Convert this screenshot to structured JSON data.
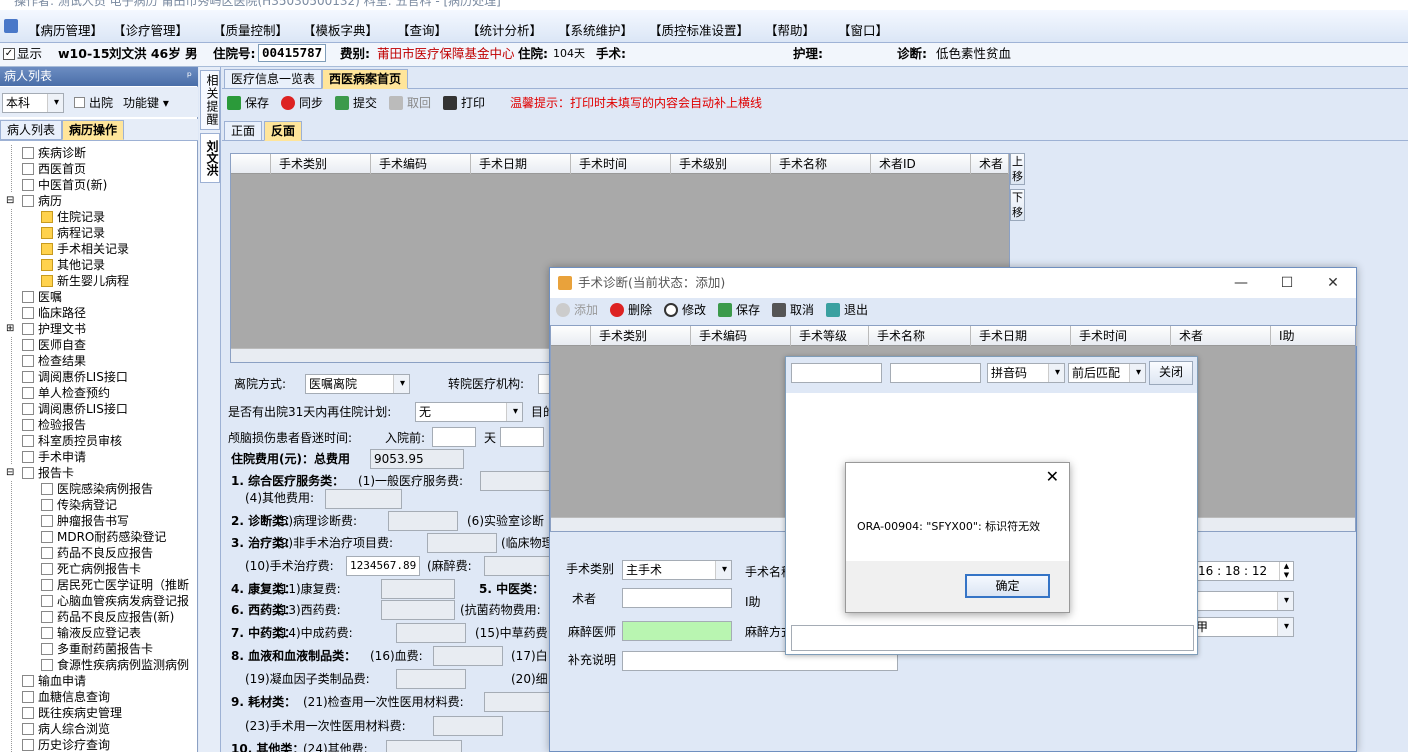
{
  "app": {
    "title_line": "操作者: 测试人员 电子病历 莆田市秀屿区医院(H35030500132) 科室: 五官科 - [病历处理]"
  },
  "menu": [
    "【病历管理】",
    "【诊疗管理】",
    "【质量控制】",
    "【模板字典】",
    "【查询】",
    "【统计分析】",
    "【系统维护】",
    "【质控标准设置】",
    "【帮助】",
    "【窗口】"
  ],
  "info": {
    "show_label": "显示",
    "bed": "w10-15",
    "patient": "刘文洪 46岁 男",
    "adm_no_label": "住院号:",
    "adm_no": "00415787",
    "insurance_label": "费别:",
    "insurance": "莆田市医疗保障基金中心",
    "stay_label": "住院:",
    "stay": "104天",
    "surgery_label": "手术:",
    "surgery": "",
    "nurse_label": "护理:",
    "nurse": "",
    "diag_label": "诊断:",
    "diag": "低色素性贫血"
  },
  "left": {
    "panel_title": "病人列表",
    "pin": "ᵖ",
    "dept": "本科",
    "discharge": "出院",
    "func_key": "功能键",
    "tab_list": "病人列表",
    "tab_ops": "病历操作",
    "tree": [
      "疾病诊断",
      "西医首页",
      "中医首页(新)",
      "病历",
      "住院记录",
      "病程记录",
      "手术相关记录",
      "其他记录",
      "新生婴儿病程",
      "医嘱",
      "临床路径",
      "护理文书",
      "医师自查",
      "检查结果",
      "调阅惠侨LIS接口",
      "单人检查预约",
      "调阅惠侨LIS接口",
      "检验报告",
      "科室质控员审核",
      "手术申请",
      "报告卡",
      "医院感染病例报告",
      "传染病登记",
      "肿瘤报告书写",
      "MDRO耐药感染登记",
      "药品不良反应报告",
      "死亡病例报告卡",
      "居民死亡医学证明（推断",
      "心脑血管疾病发病登记报",
      "药品不良反应报告(新)",
      "输液反应登记表",
      "多重耐药菌报告卡",
      "食源性疾病病例监测病例",
      "输血申请",
      "血糖信息查询",
      "既往疾病史管理",
      "病人综合浏览",
      "历史诊疗查询"
    ]
  },
  "side": {
    "tab_remind": "相关提醒",
    "tab_patient": "刘文洪"
  },
  "main": {
    "tab_overview": "医疗信息一览表",
    "tab_front": "西医病案首页",
    "toolbar": {
      "save": "保存",
      "sync": "同步",
      "submit": "提交",
      "cancel": "取回",
      "print": "打印",
      "tip": "温馨提示：打印时未填写的内容会自动补上横线"
    },
    "subtab_front": "正面",
    "subtab_back": "反面",
    "grid_cols": [
      "手术类别",
      "手术编码",
      "手术日期",
      "手术时间",
      "手术级别",
      "手术名称",
      "术者ID",
      "术者"
    ],
    "up_btn": "上移",
    "down_btn": "下移",
    "form": {
      "leave_mode_label": "离院方式:",
      "leave_mode": "医嘱离院",
      "transfer_label": "转院医疗机构:",
      "readmit_label": "是否有出院31天内再住院计划:",
      "readmit": "无",
      "purpose_label": "目的",
      "coma_label": "颅脑损伤患者昏迷时间:",
      "before_label": "入院前:",
      "day_label": "天",
      "fee_title": "住院费用(元)：总费用",
      "fee_total": "9053.95",
      "c1": "1. 综合医疗服务类：",
      "c1a": "(1)一般医疗服务费:",
      "c1b": "(4)其他费用:",
      "c2": "2. 诊断类：",
      "c2a": "(5)病理诊断费:",
      "c2b": "(6)实验室诊断",
      "c3": "3. 治疗类：",
      "c3a": "(9)非手术治疗项目费:",
      "c3b": "(临床物理",
      "c3c": "(10)手术治疗费:",
      "c3c_val": "1234567.89",
      "c3d": "(麻醉费:",
      "c4": "4. 康复类：",
      "c4a": "(11)康复费:",
      "c5": "5. 中医类：",
      "c6": "6. 西药类：",
      "c6a": "(13)西药费:",
      "c6b": "(抗菌药物费用:",
      "c7": "7. 中药类：",
      "c7a": "(14)中成药费:",
      "c7b": "(15)中草药费",
      "c8": "8. 血液和血液制品类：",
      "c8a": "(16)血费:",
      "c8b": "(17)白",
      "c8c": "(19)凝血因子类制品费:",
      "c8d": "(20)细",
      "c9": "9. 耗材类：",
      "c9a": "(21)检查用一次性医用材料费:",
      "c9b": "(23)手术用一次性医用材料费:",
      "c10": "10. 其他类：",
      "c10a": "(24)其他费:"
    }
  },
  "surgery_win": {
    "title": "手术诊断(当前状态：添加)",
    "add": "添加",
    "del": "删除",
    "edit": "修改",
    "save": "保存",
    "cancel": "取消",
    "exit": "退出",
    "cols": [
      "手术类别",
      "手术编码",
      "手术等级",
      "手术名称",
      "手术日期",
      "手术时间",
      "术者",
      "I助"
    ],
    "type_label": "手术类别",
    "type_val": "主手术",
    "name_label": "手术名称",
    "surgeon_label": "术者",
    "assist_label": "I助",
    "anes_doc_label": "麻醉医师",
    "anes_method_label": "麻醉方式",
    "note_label": "补充说明",
    "time_val": "16 : 18 : 12",
    "right_sel3": "甲"
  },
  "search_popup": {
    "mode": "拼音码",
    "match": "前后匹配",
    "close": "关闭"
  },
  "alert": {
    "message": "ORA-00904: \"SFYX00\": 标识符无效",
    "ok": "确定"
  }
}
